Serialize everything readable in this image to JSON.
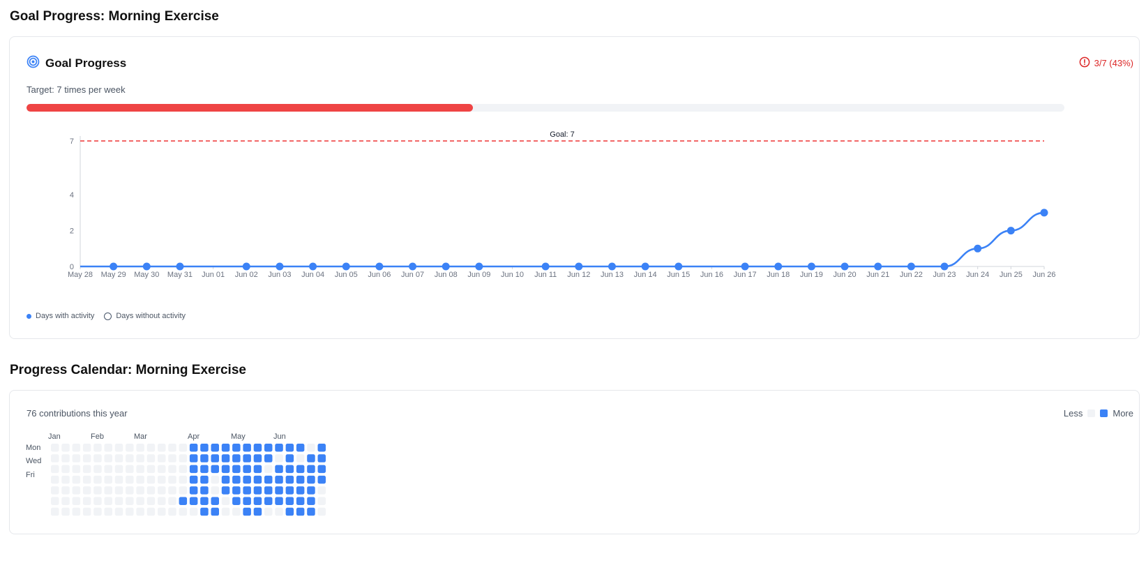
{
  "goal_section": {
    "title": "Goal Progress: Morning Exercise",
    "card_title": "Goal Progress",
    "icon": "target-icon",
    "status_text": "3/7 (43%)",
    "status_icon": "alert-circle-icon",
    "target_text": "Target: 7 times per week",
    "progress_fraction": 0.43,
    "colors": {
      "progress": "#ef4444",
      "track": "#f1f3f6",
      "line": "#3b82f6",
      "goal_line": "#ef4444",
      "status": "#dc2626"
    }
  },
  "chart_data": {
    "type": "line",
    "categories": [
      "May 28",
      "May 29",
      "May 30",
      "May 31",
      "Jun 01",
      "Jun 02",
      "Jun 03",
      "Jun 04",
      "Jun 05",
      "Jun 06",
      "Jun 07",
      "Jun 08",
      "Jun 09",
      "Jun 10",
      "Jun 11",
      "Jun 12",
      "Jun 13",
      "Jun 14",
      "Jun 15",
      "Jun 16",
      "Jun 17",
      "Jun 18",
      "Jun 19",
      "Jun 20",
      "Jun 21",
      "Jun 22",
      "Jun 23",
      "Jun 24",
      "Jun 25",
      "Jun 26"
    ],
    "values": [
      0,
      0,
      0,
      0,
      0,
      0,
      0,
      0,
      0,
      0,
      0,
      0,
      0,
      0,
      0,
      0,
      0,
      0,
      0,
      0,
      0,
      0,
      0,
      0,
      0,
      0,
      0,
      1,
      2,
      3
    ],
    "active": [
      false,
      true,
      true,
      true,
      false,
      true,
      true,
      true,
      true,
      true,
      true,
      true,
      true,
      false,
      true,
      true,
      true,
      true,
      true,
      false,
      true,
      true,
      true,
      true,
      true,
      true,
      true,
      true,
      true,
      true
    ],
    "y_ticks": [
      0,
      2,
      4,
      7
    ],
    "ylim": [
      0,
      7
    ],
    "goal": 7,
    "goal_label": "Goal: 7",
    "legend": [
      "Days with activity",
      "Days without activity"
    ],
    "legend_placement": "bottom-left"
  },
  "calendar_section": {
    "title": "Progress Calendar: Morning Exercise",
    "contributions_text": "76 contributions this year",
    "legend_less": "Less",
    "legend_more": "More",
    "months": [
      "Jan",
      "Feb",
      "Mar",
      "Apr",
      "May",
      "Jun"
    ],
    "day_labels": [
      "Mon",
      "Wed",
      "Fri"
    ],
    "colors": {
      "empty": "#f1f3f6",
      "filled": "#3b82f6"
    },
    "weeks": [
      [
        0,
        0,
        0,
        0,
        0,
        0,
        0
      ],
      [
        0,
        0,
        0,
        0,
        0,
        0,
        0
      ],
      [
        0,
        0,
        0,
        0,
        0,
        0,
        0
      ],
      [
        0,
        0,
        0,
        0,
        0,
        0,
        0
      ],
      [
        0,
        0,
        0,
        0,
        0,
        0,
        0
      ],
      [
        0,
        0,
        0,
        0,
        0,
        0,
        0
      ],
      [
        0,
        0,
        0,
        0,
        0,
        0,
        0
      ],
      [
        0,
        0,
        0,
        0,
        0,
        0,
        0
      ],
      [
        0,
        0,
        0,
        0,
        0,
        0,
        0
      ],
      [
        0,
        0,
        0,
        0,
        0,
        0,
        0
      ],
      [
        0,
        0,
        0,
        0,
        0,
        0,
        0
      ],
      [
        0,
        0,
        0,
        0,
        0,
        0,
        0
      ],
      [
        0,
        0,
        0,
        0,
        0,
        1,
        0
      ],
      [
        1,
        1,
        1,
        1,
        1,
        1,
        0
      ],
      [
        1,
        1,
        1,
        1,
        1,
        1,
        1
      ],
      [
        1,
        1,
        1,
        0,
        0,
        1,
        1
      ],
      [
        1,
        1,
        1,
        1,
        1,
        0,
        0
      ],
      [
        1,
        1,
        1,
        1,
        1,
        1,
        0
      ],
      [
        1,
        1,
        1,
        1,
        1,
        1,
        1
      ],
      [
        1,
        1,
        1,
        1,
        1,
        1,
        1
      ],
      [
        1,
        1,
        0,
        1,
        1,
        1,
        0
      ],
      [
        1,
        0,
        1,
        1,
        1,
        1,
        0
      ],
      [
        1,
        1,
        1,
        1,
        1,
        1,
        1
      ],
      [
        1,
        0,
        1,
        1,
        1,
        1,
        1
      ],
      [
        0,
        1,
        1,
        1,
        1,
        1,
        1
      ],
      [
        1,
        1,
        1,
        1,
        0,
        0,
        0
      ]
    ]
  }
}
